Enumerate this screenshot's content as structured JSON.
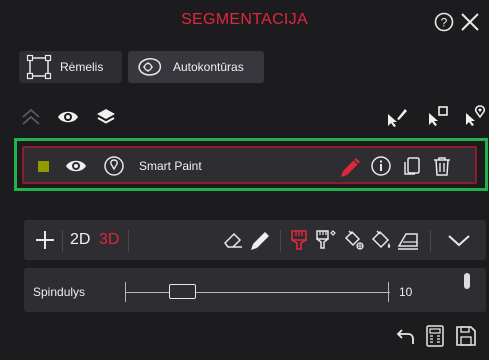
{
  "header": {
    "title": "SEGMENTACIJA",
    "help_icon": "question-circle-icon",
    "close_icon": "close-x-icon",
    "title_color": "#e0283c"
  },
  "mode_tabs": [
    {
      "label": "Rėmelis",
      "icon": "bounding-box-icon"
    },
    {
      "label": "Autokontūras",
      "icon": "autocontour-icon",
      "selected": true
    }
  ],
  "layer_toolbar": {
    "icons": [
      "collapse-up-icon",
      "eye-icon",
      "layers-icon",
      "pointer-pen-icon",
      "pointer-box-icon",
      "pointer-pin-icon"
    ]
  },
  "layer": {
    "name": "Smart Paint",
    "color": "#8f9b00",
    "icons": [
      "eye-icon",
      "location-pin-icon",
      "paint-pencil-icon",
      "info-icon",
      "copy-icon",
      "trash-icon"
    ],
    "highlight_color": "#24b04a"
  },
  "segment_toolbar": {
    "add_icon": "plus-icon",
    "mode_2d": "2D",
    "mode_3d": "3D",
    "active_mode": "3D",
    "tools": [
      "eraser-icon",
      "pencil-icon",
      "brush-icon",
      "magic-brush-icon",
      "fill-icon",
      "bucket-icon",
      "ruler-icon",
      "chevron-down-icon"
    ]
  },
  "radius": {
    "label": "Spindulys",
    "value": "10",
    "level": 0.22
  },
  "footer": {
    "icons": [
      "undo-icon",
      "calculator-icon",
      "save-icon"
    ]
  }
}
